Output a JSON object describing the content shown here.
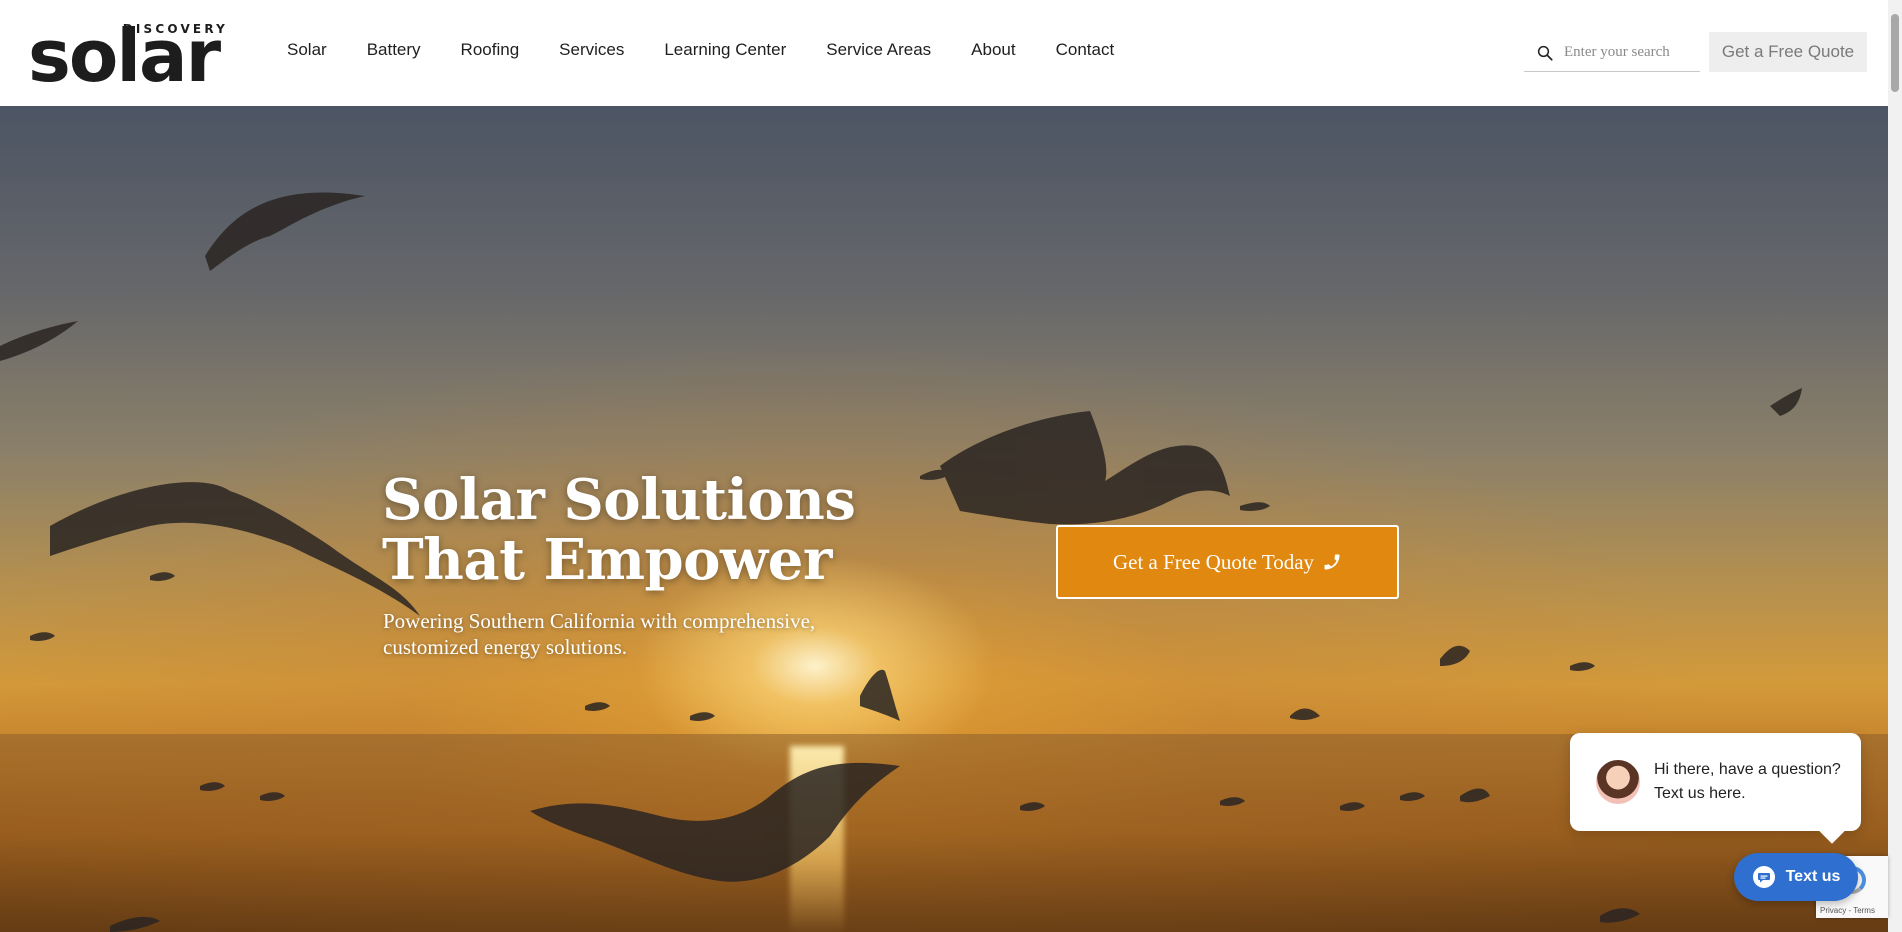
{
  "brand": {
    "logo_small": "DISCOVERY",
    "logo_big": "solar"
  },
  "nav": {
    "items": [
      {
        "label": "Solar"
      },
      {
        "label": "Battery"
      },
      {
        "label": "Roofing"
      },
      {
        "label": "Services"
      },
      {
        "label": "Learning Center"
      },
      {
        "label": "Service Areas"
      },
      {
        "label": "About"
      },
      {
        "label": "Contact"
      }
    ]
  },
  "search": {
    "placeholder": "Enter your search"
  },
  "header": {
    "quote_label": "Get a Free Quote"
  },
  "hero": {
    "title_line1": "Solar Solutions",
    "title_line2": "That Empower",
    "subtitle": "Powering Southern California with comprehensive, customized energy solutions.",
    "cta_label": "Get a Free Quote Today"
  },
  "chat": {
    "message": "Hi there, have a question? Text us here.",
    "button_label": "Text us"
  },
  "recaptcha": {
    "links": "Privacy - Terms"
  },
  "colors": {
    "accent": "#e0880f",
    "chat_blue": "#2f6fcf",
    "text_dark": "#1f1f1f"
  },
  "icons": {
    "search": "search-icon",
    "phone": "phone-icon",
    "chat": "chat-icon"
  }
}
